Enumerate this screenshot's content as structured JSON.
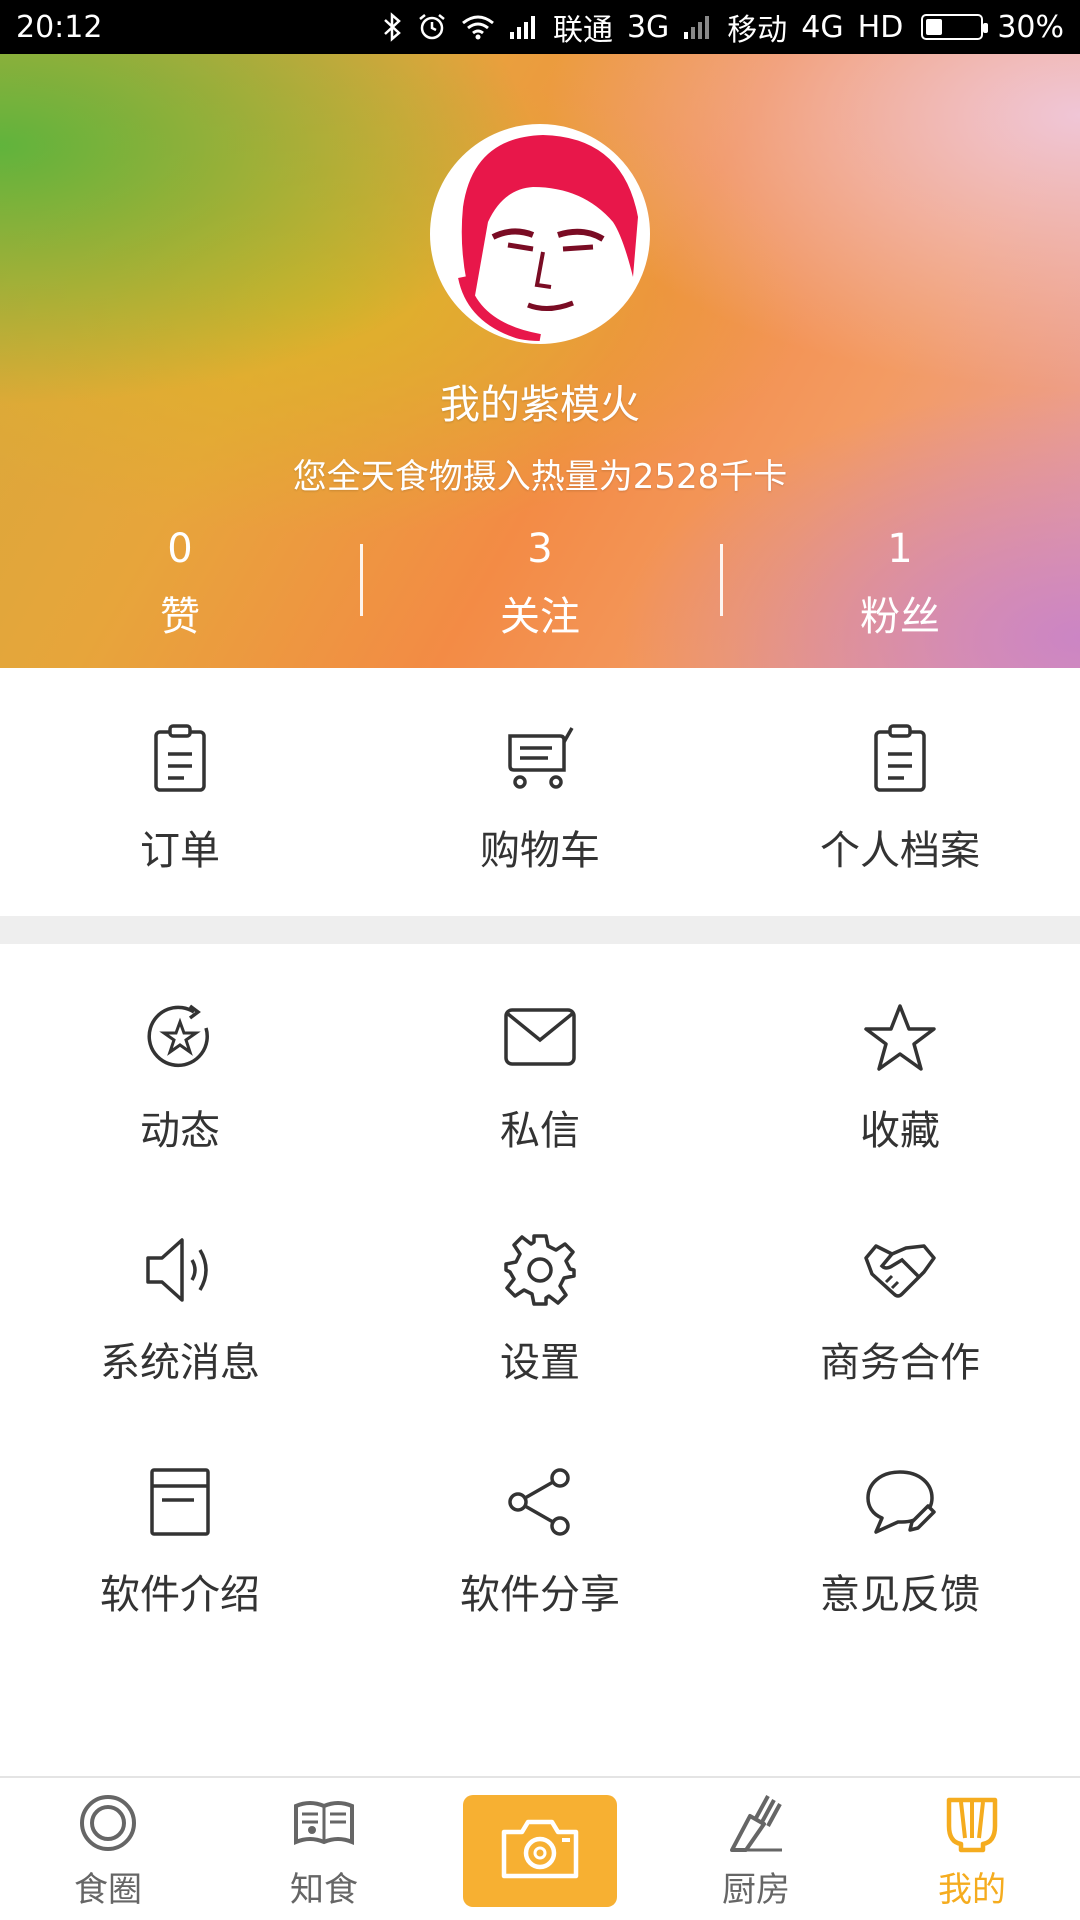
{
  "status_bar": {
    "time": "20:12",
    "carrier1": "联通",
    "net1": "3G",
    "carrier2": "移动",
    "net2": "4G",
    "hd": "HD",
    "battery": "30%",
    "battery_level": 0.3,
    "icons": [
      "bluetooth-icon",
      "alarm-icon",
      "wifi-icon",
      "signal-icon",
      "signal-icon",
      "battery-icon"
    ]
  },
  "profile": {
    "username": "我的紫模火",
    "calories_text": "您全天食物摄入热量为2528千卡",
    "stats": [
      {
        "value": "0",
        "label": "赞"
      },
      {
        "value": "3",
        "label": "关注"
      },
      {
        "value": "1",
        "label": "粉丝"
      }
    ]
  },
  "top_menu": [
    {
      "label": "订单",
      "icon": "clipboard-icon"
    },
    {
      "label": "购物车",
      "icon": "cart-icon"
    },
    {
      "label": "个人档案",
      "icon": "clipboard-icon"
    }
  ],
  "grid_menu": [
    {
      "label": "动态",
      "icon": "refresh-star-icon"
    },
    {
      "label": "私信",
      "icon": "mail-icon"
    },
    {
      "label": "收藏",
      "icon": "star-icon"
    },
    {
      "label": "系统消息",
      "icon": "speaker-icon"
    },
    {
      "label": "设置",
      "icon": "gear-icon"
    },
    {
      "label": "商务合作",
      "icon": "handshake-icon"
    },
    {
      "label": "软件介绍",
      "icon": "document-icon"
    },
    {
      "label": "软件分享",
      "icon": "share-icon"
    },
    {
      "label": "意见反馈",
      "icon": "feedback-icon"
    }
  ],
  "bottom_nav": [
    {
      "label": "食圈",
      "icon": "circle-icon"
    },
    {
      "label": "知食",
      "icon": "book-icon"
    },
    {
      "label": "",
      "icon": "camera-icon"
    },
    {
      "label": "厨房",
      "icon": "knife-icon"
    },
    {
      "label": "我的",
      "icon": "chef-hat-icon",
      "active": true
    }
  ],
  "colors": {
    "accent": "#f5ac1f",
    "camera_bg": "#f7b032",
    "text": "#333333"
  }
}
